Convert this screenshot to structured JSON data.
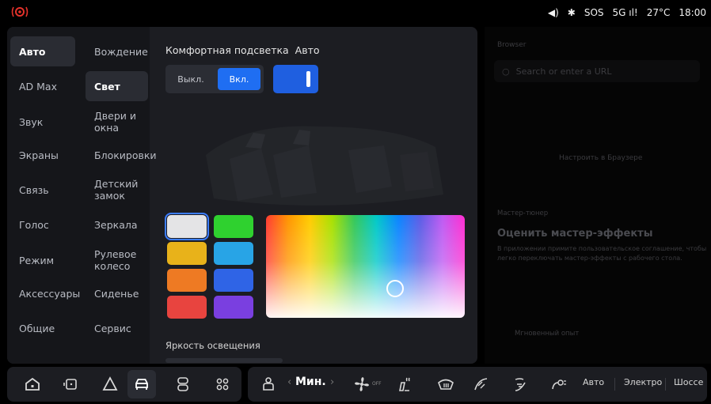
{
  "status": {
    "sos": "SOS",
    "network": "5G",
    "temperature": "27°C",
    "time": "18:00"
  },
  "sidebar": {
    "items": [
      {
        "label": "Авто",
        "active": true
      },
      {
        "label": "AD Max"
      },
      {
        "label": "Звук"
      },
      {
        "label": "Экраны"
      },
      {
        "label": "Связь"
      },
      {
        "label": "Голос"
      },
      {
        "label": "Режим"
      },
      {
        "label": "Аксессуары"
      },
      {
        "label": "Общие"
      }
    ]
  },
  "subnav": {
    "items": [
      {
        "label": "Вождение"
      },
      {
        "label": "Свет",
        "active": true
      },
      {
        "label": "Двери и окна"
      },
      {
        "label": "Блокировки"
      },
      {
        "label": "Детский замок"
      },
      {
        "label": "Зеркала"
      },
      {
        "label": "Рулевое колесо"
      },
      {
        "label": "Сиденье"
      },
      {
        "label": "Сервис"
      }
    ]
  },
  "ambient": {
    "title": "Комфортная подсветка",
    "auto_label": "Авто",
    "off_label": "Выкл.",
    "on_label": "Вкл.",
    "auto_enabled": true,
    "swatches": [
      "#e4e4e6",
      "#2fd12f",
      "#e8b21a",
      "#28a4e6",
      "#ee7a23",
      "#2f64e6",
      "#e8443f",
      "#7a3fe0"
    ],
    "selected_swatch": 0,
    "brightness_label": "Яркость освещения"
  },
  "browser": {
    "label": "Browser",
    "search_placeholder": "Search or enter a URL",
    "mid_text": "Настроить в Браузере"
  },
  "tuner": {
    "label": "Мастер-тюнер",
    "heading": "Оценить мастер-эффекты",
    "description": "В приложении примите пользовательское соглашение, чтобы легко переключать мастер-эффекты с рабочего стола.",
    "instant": "Мгновенный опыт"
  },
  "dock": {
    "fan_label": "Мин.",
    "fan_prev": "‹",
    "fan_next": "›",
    "off_small": "OFF",
    "modes": [
      "Авто",
      "Электро",
      "Шоссе"
    ]
  }
}
